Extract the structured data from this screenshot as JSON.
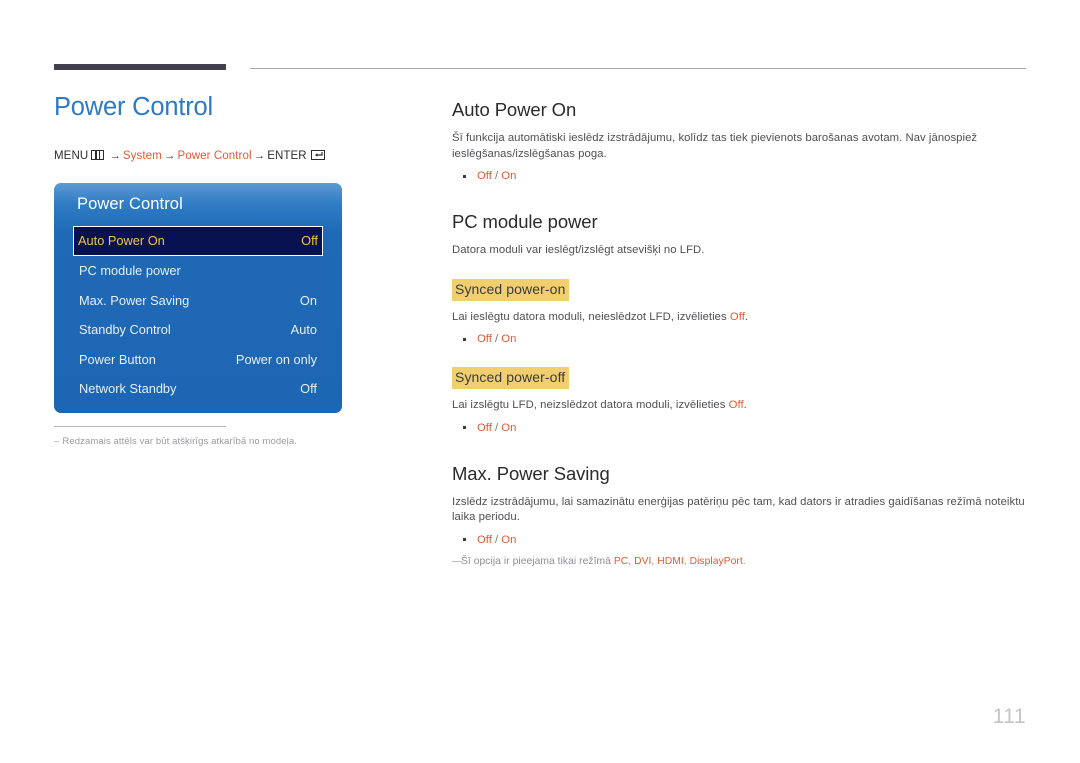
{
  "page": {
    "title": "Power Control",
    "number": "111"
  },
  "breadcrumb": {
    "menu_label": "MENU",
    "menu_icon": "menu-grid-icon",
    "arrow": "→",
    "item1": "System",
    "item2": "Power Control",
    "enter_label": "ENTER",
    "enter_icon": "enter-key-icon"
  },
  "osd": {
    "title": "Power Control",
    "rows": [
      {
        "label": "Auto Power On",
        "value": "Off",
        "selected": true
      },
      {
        "label": "PC module power",
        "value": "",
        "selected": false
      },
      {
        "label": "Max. Power Saving",
        "value": "On",
        "selected": false
      },
      {
        "label": "Standby Control",
        "value": "Auto",
        "selected": false
      },
      {
        "label": "Power Button",
        "value": "Power on only",
        "selected": false
      },
      {
        "label": "Network Standby",
        "value": "Off",
        "selected": false
      }
    ]
  },
  "figure_note": {
    "dash": "–",
    "text": "Redzamais attēls var būt atšķirīgs atkarībā no modeļa."
  },
  "sections": [
    {
      "heading": "Auto Power On",
      "body": "Šī funkcija automātiski ieslēdz izstrādājumu, kolīdz tas tiek pievienots barošanas avotam. Nav jānospiež ieslēgšanas/izslēgšanas poga.",
      "option_off": "Off",
      "option_sep": " / ",
      "option_on": "On"
    },
    {
      "heading": "PC module power",
      "body": "Datora moduli var ieslēgt/izslēgt atsevišķi no LFD.",
      "sub1_title": "Synced power-on",
      "sub1_body_before": "Lai ieslēgtu datora moduli, neieslēdzot LFD, izvēlieties ",
      "sub1_body_word": "Off",
      "sub1_body_after": ".",
      "sub2_title": "Synced power-off",
      "sub2_body_before": "Lai izslēgtu LFD, neizslēdzot datora moduli, izvēlieties ",
      "sub2_body_word": "Off",
      "sub2_body_after": ".",
      "option_off": "Off",
      "option_sep": " / ",
      "option_on": "On"
    },
    {
      "heading": "Max. Power Saving",
      "body": "Izslēdz izstrādājumu, lai samazinātu enerģijas patēriņu pēc tam, kad dators ir atradies gaidīšanas režīmā noteiktu laika periodu.",
      "option_off": "Off",
      "option_sep": " / ",
      "option_on": "On",
      "note_dash": "—",
      "note_before": "Šī opcija ir pieejama tikai režīmā ",
      "note_mode1": "PC",
      "note_mode2": "DVI",
      "note_mode3": "HDMI",
      "note_mode4": "DisplayPort",
      "note_comma": ", ",
      "note_after": "."
    }
  ],
  "colors": {
    "title_blue": "#2f79c4",
    "accent_orange": "#e05a33",
    "osd_blue": "#1c66b3",
    "osd_selected_bg": "#081251",
    "osd_selected_text": "#f4c33c",
    "highlight_gold": "#f1cf6f",
    "header_bar": "#423f4e"
  }
}
